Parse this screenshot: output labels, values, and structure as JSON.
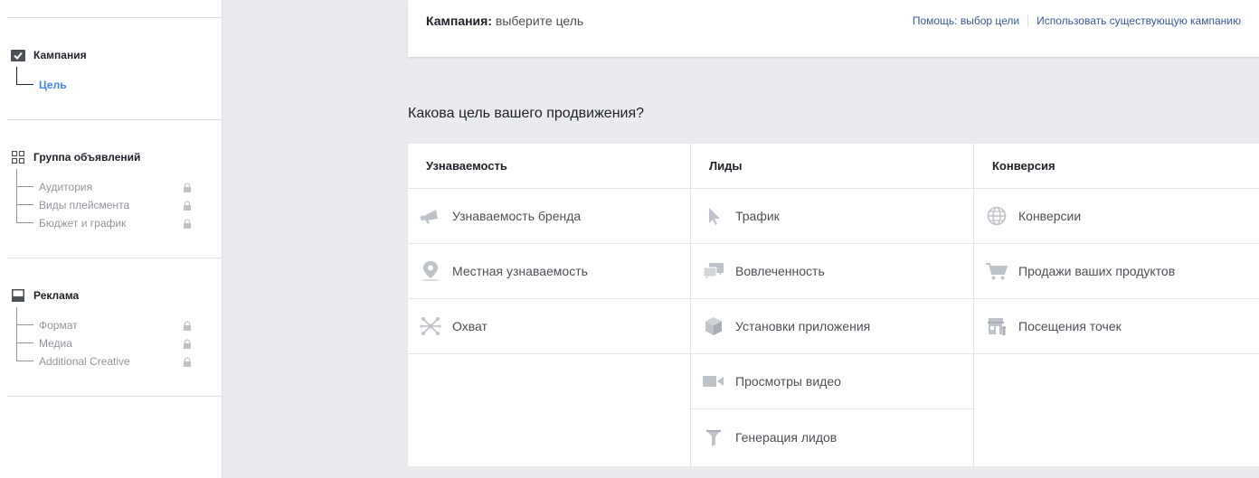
{
  "sidebar": {
    "campaign": {
      "label": "Кампания",
      "items": [
        {
          "label": "Цель"
        }
      ]
    },
    "adset": {
      "label": "Группа объявлений",
      "items": [
        {
          "label": "Аудитория"
        },
        {
          "label": "Виды плейсмента"
        },
        {
          "label": "Бюджет и график"
        }
      ]
    },
    "ad": {
      "label": "Реклама",
      "items": [
        {
          "label": "Формат"
        },
        {
          "label": "Медиа"
        },
        {
          "label": "Additional Creative"
        }
      ]
    }
  },
  "header": {
    "title_bold": "Кампания:",
    "title_rest": "выберите цель",
    "help_link": "Помощь: выбор цели",
    "existing_link": "Использовать существующую кампанию"
  },
  "question": "Какова цель вашего продвижения?",
  "columns": [
    {
      "title": "Узнаваемость",
      "options": [
        {
          "label": "Узнаваемость бренда",
          "icon": "megaphone-icon"
        },
        {
          "label": "Местная узнаваемость",
          "icon": "location-pin-icon"
        },
        {
          "label": "Охват",
          "icon": "reach-icon"
        }
      ]
    },
    {
      "title": "Лиды",
      "options": [
        {
          "label": "Трафик",
          "icon": "cursor-icon"
        },
        {
          "label": "Вовлеченность",
          "icon": "chat-bubbles-icon"
        },
        {
          "label": "Установки приложения",
          "icon": "box-icon"
        },
        {
          "label": "Просмотры видео",
          "icon": "video-camera-icon"
        },
        {
          "label": "Генерация лидов",
          "icon": "funnel-icon"
        }
      ]
    },
    {
      "title": "Конверсия",
      "options": [
        {
          "label": "Конверсии",
          "icon": "globe-icon"
        },
        {
          "label": "Продажи ваших продуктов",
          "icon": "cart-icon"
        },
        {
          "label": "Посещения точек",
          "icon": "store-icon"
        }
      ]
    }
  ],
  "colors": {
    "icon": "#bec3c9",
    "link": "#365899",
    "active": "#4080ff",
    "background": "#e9ebee"
  }
}
